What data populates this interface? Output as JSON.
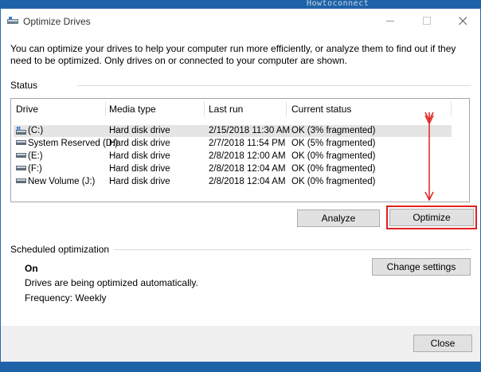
{
  "watermark": "Howtoconnect",
  "window": {
    "title": "Optimize Drives",
    "controls": {
      "minimize": "minimize",
      "maximize": "maximize",
      "close": "close"
    }
  },
  "intro": "You can optimize your drives to help your computer run more efficiently, or analyze them to find out if they need to be optimized. Only drives on or connected to your computer are shown.",
  "status": {
    "label": "Status",
    "columns": [
      "Drive",
      "Media type",
      "Last run",
      "Current status"
    ],
    "drives": [
      {
        "drive": "(C:)",
        "media": "Hard disk drive",
        "last_run": "2/15/2018 11:30 AM",
        "status": "OK (3% fragmented)",
        "selected": true,
        "icon": "windows-drive-icon"
      },
      {
        "drive": "System Reserved (D:)",
        "media": "Hard disk drive",
        "last_run": "2/7/2018 11:54 PM",
        "status": "OK (5% fragmented)",
        "selected": false,
        "icon": "hard-drive-icon"
      },
      {
        "drive": "(E:)",
        "media": "Hard disk drive",
        "last_run": "2/8/2018 12:00 AM",
        "status": "OK (0% fragmented)",
        "selected": false,
        "icon": "hard-drive-icon"
      },
      {
        "drive": "(F:)",
        "media": "Hard disk drive",
        "last_run": "2/8/2018 12:04 AM",
        "status": "OK (0% fragmented)",
        "selected": false,
        "icon": "hard-drive-icon"
      },
      {
        "drive": "New Volume (J:)",
        "media": "Hard disk drive",
        "last_run": "2/8/2018 12:04 AM",
        "status": "OK (0% fragmented)",
        "selected": false,
        "icon": "hard-drive-icon"
      }
    ]
  },
  "buttons": {
    "analyze": "Analyze",
    "optimize": "Optimize",
    "change_settings": "Change settings",
    "close": "Close"
  },
  "scheduled": {
    "label": "Scheduled optimization",
    "state": "On",
    "description": "Drives are being optimized automatically.",
    "frequency": "Frequency: Weekly"
  },
  "colors": {
    "highlight": "#e02020",
    "selected_row": "#e5e5e5",
    "button_face": "#e1e1e1",
    "desktop": "#1e63a8"
  }
}
